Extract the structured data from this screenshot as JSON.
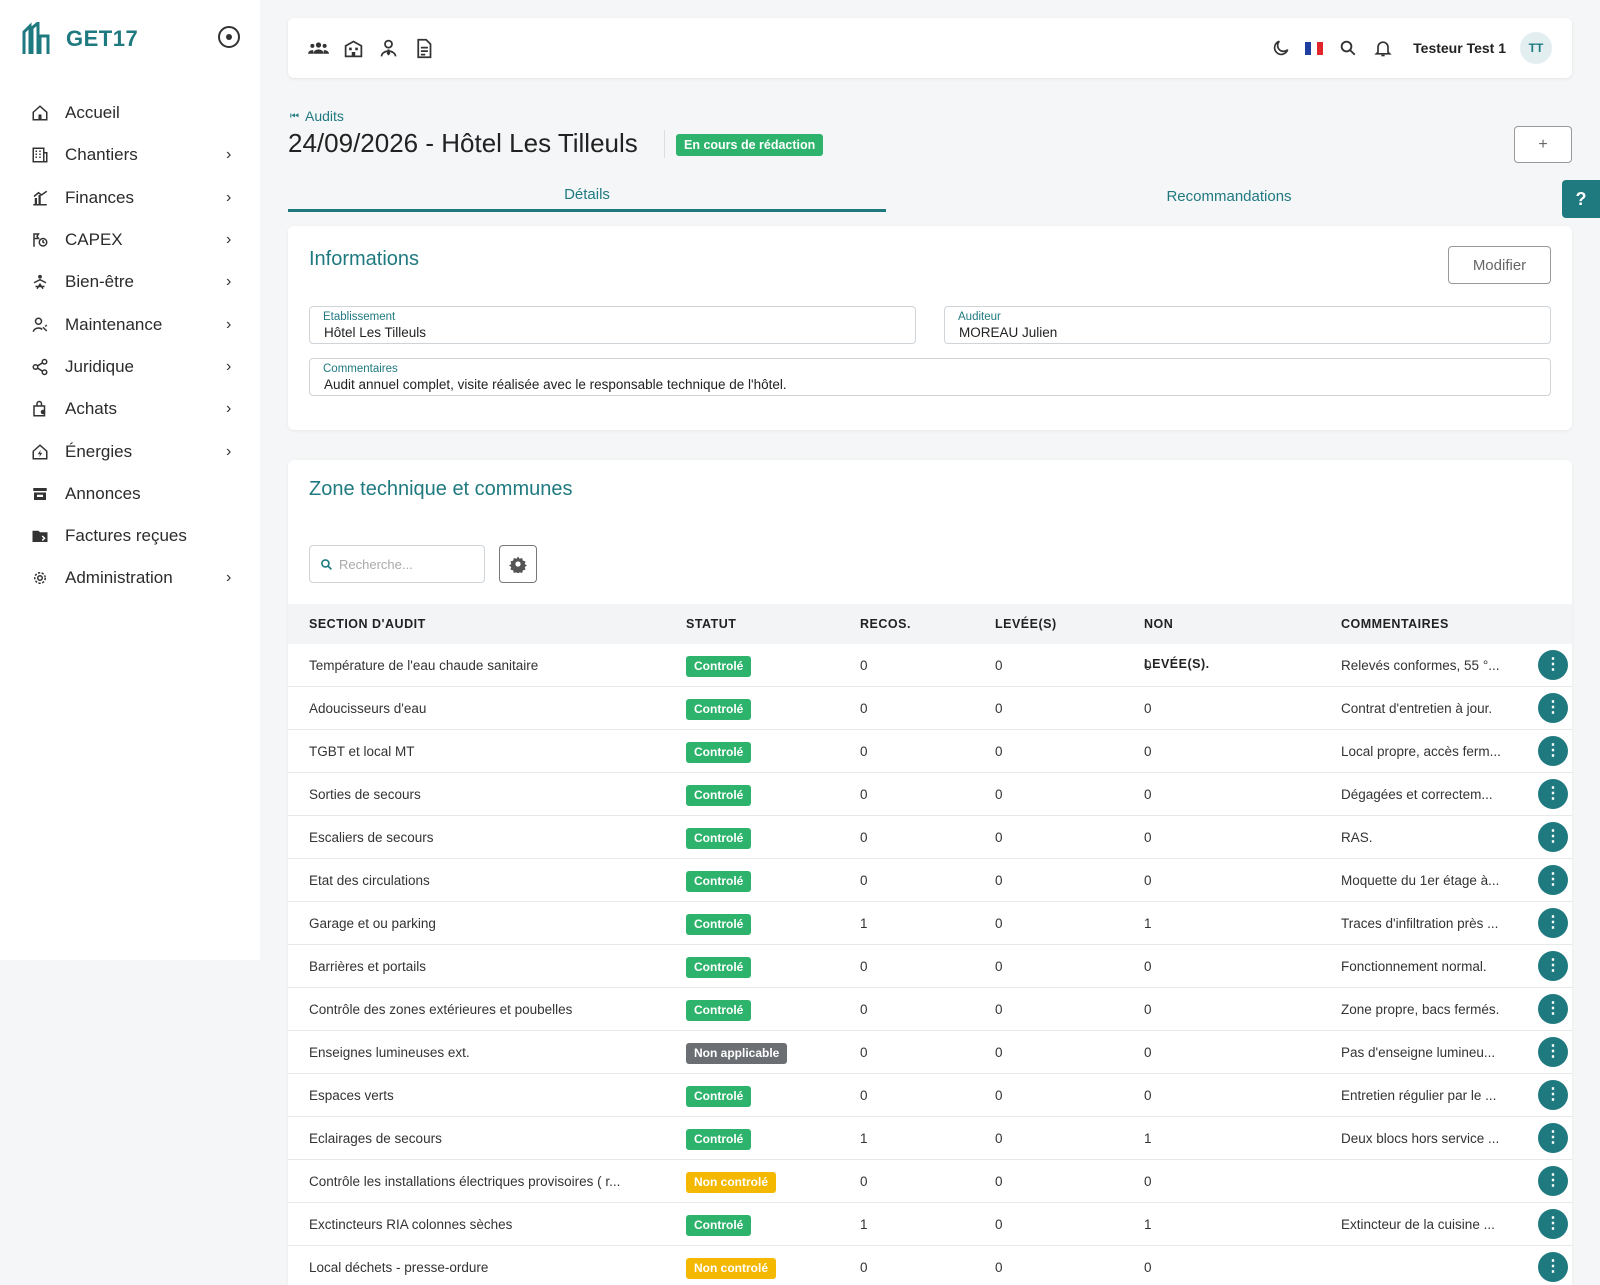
{
  "app": {
    "name": "GET17",
    "accent": "#1f7a80"
  },
  "sidebar": {
    "items": [
      {
        "label": "Accueil",
        "icon": "home-icon",
        "has_children": false
      },
      {
        "label": "Chantiers",
        "icon": "building-icon",
        "has_children": true
      },
      {
        "label": "Finances",
        "icon": "finance-chart-icon",
        "has_children": true
      },
      {
        "label": "CAPEX",
        "icon": "capex-icon",
        "has_children": true
      },
      {
        "label": "Bien-être",
        "icon": "wellbeing-icon",
        "has_children": true
      },
      {
        "label": "Maintenance",
        "icon": "maintenance-user-icon",
        "has_children": true
      },
      {
        "label": "Juridique",
        "icon": "share-icon",
        "has_children": true
      },
      {
        "label": "Achats",
        "icon": "shopping-bag-icon",
        "has_children": true
      },
      {
        "label": "Énergies",
        "icon": "energy-home-icon",
        "has_children": true
      },
      {
        "label": "Annonces",
        "icon": "store-icon",
        "has_children": false
      },
      {
        "label": "Factures reçues",
        "icon": "folder-icon",
        "has_children": false
      },
      {
        "label": "Administration",
        "icon": "gear-icon",
        "has_children": true
      }
    ]
  },
  "topbar": {
    "left_icons": [
      "users-icon",
      "building-grid-icon",
      "user-tie-icon",
      "document-icon"
    ],
    "user_name": "Testeur Test 1",
    "avatar_initials": "TT"
  },
  "page": {
    "breadcrumb": "Audits",
    "title": "24/09/2026 - Hôtel Les Tilleuls",
    "status": "En cours de rédaction",
    "status_color": "#2db36b",
    "plus_label": "+",
    "help_label": "?"
  },
  "tabs": [
    {
      "label": "Détails",
      "active": true
    },
    {
      "label": "Recommandations",
      "active": false
    }
  ],
  "info": {
    "title": "Informations",
    "modify_label": "Modifier",
    "etablissement_label": "Etablissement",
    "etablissement_value": "Hôtel Les Tilleuls",
    "auditeur_label": "Auditeur",
    "auditeur_value": "MOREAU Julien",
    "commentaires_label": "Commentaires",
    "commentaires_value": "Audit annuel complet, visite réalisée avec le responsable technique de l'hôtel."
  },
  "zone": {
    "title": "Zone technique et communes",
    "search_placeholder": "Recherche...",
    "columns": [
      "SECTION D'AUDIT",
      "STATUT",
      "RECOS.",
      "LEVÉE(S)",
      "NON LEVÉE(S).",
      "COMMENTAIRES"
    ],
    "status_colors": {
      "Controlé": "#2db36b",
      "Non applicable": "#6b6f73",
      "Non controlé": "#f5b800"
    },
    "rows": [
      {
        "section": "Température de l'eau chaude sanitaire",
        "statut": "Controlé",
        "recos": "0",
        "levees": "0",
        "non_levees": "0",
        "commentaire": "Relevés conformes, 55 °..."
      },
      {
        "section": "Adoucisseurs d'eau",
        "statut": "Controlé",
        "recos": "0",
        "levees": "0",
        "non_levees": "0",
        "commentaire": "Contrat d'entretien à jour."
      },
      {
        "section": "TGBT et local MT",
        "statut": "Controlé",
        "recos": "0",
        "levees": "0",
        "non_levees": "0",
        "commentaire": "Local propre, accès ferm..."
      },
      {
        "section": "Sorties de secours",
        "statut": "Controlé",
        "recos": "0",
        "levees": "0",
        "non_levees": "0",
        "commentaire": "Dégagées et correctem..."
      },
      {
        "section": "Escaliers de secours",
        "statut": "Controlé",
        "recos": "0",
        "levees": "0",
        "non_levees": "0",
        "commentaire": "RAS."
      },
      {
        "section": "Etat des circulations",
        "statut": "Controlé",
        "recos": "0",
        "levees": "0",
        "non_levees": "0",
        "commentaire": "Moquette du 1er étage à..."
      },
      {
        "section": "Garage et ou parking",
        "statut": "Controlé",
        "recos": "1",
        "levees": "0",
        "non_levees": "1",
        "commentaire": "Traces d'infiltration près ..."
      },
      {
        "section": "Barrières et portails",
        "statut": "Controlé",
        "recos": "0",
        "levees": "0",
        "non_levees": "0",
        "commentaire": "Fonctionnement normal."
      },
      {
        "section": "Contrôle des zones extérieures et poubelles",
        "statut": "Controlé",
        "recos": "0",
        "levees": "0",
        "non_levees": "0",
        "commentaire": "Zone propre, bacs fermés."
      },
      {
        "section": "Enseignes lumineuses ext.",
        "statut": "Non applicable",
        "recos": "0",
        "levees": "0",
        "non_levees": "0",
        "commentaire": "Pas d'enseigne lumineu..."
      },
      {
        "section": "Espaces verts",
        "statut": "Controlé",
        "recos": "0",
        "levees": "0",
        "non_levees": "0",
        "commentaire": "Entretien régulier par le ..."
      },
      {
        "section": "Eclairages de secours",
        "statut": "Controlé",
        "recos": "1",
        "levees": "0",
        "non_levees": "1",
        "commentaire": "Deux blocs hors service ..."
      },
      {
        "section": "Contrôle les installations électriques provisoires ( r...",
        "statut": "Non controlé",
        "recos": "0",
        "levees": "0",
        "non_levees": "0",
        "commentaire": ""
      },
      {
        "section": "Exctincteurs RIA colonnes sèches",
        "statut": "Controlé",
        "recos": "1",
        "levees": "0",
        "non_levees": "1",
        "commentaire": "Extincteur de la cuisine ..."
      },
      {
        "section": "Local déchets - presse-ordure",
        "statut": "Non controlé",
        "recos": "0",
        "levees": "0",
        "non_levees": "0",
        "commentaire": ""
      }
    ]
  }
}
